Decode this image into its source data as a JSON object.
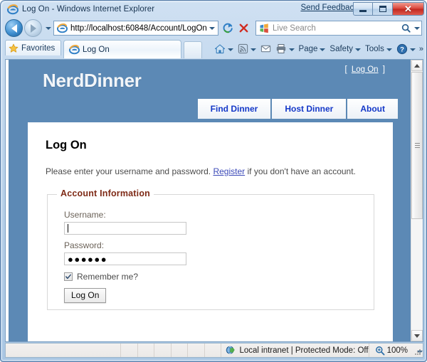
{
  "window": {
    "title": "Log On - Windows Internet Explorer",
    "favicon": "ie-logo-icon",
    "send_feedback": "Send Feedback",
    "buttons": {
      "minimize": "minimize-button",
      "maximize": "maximize-button",
      "close": "close-button",
      "close_glyph": "✕"
    }
  },
  "address_bar": {
    "back": "back-button",
    "forward": "forward-button",
    "recent_pages": "recent-pages-dropdown",
    "url": "http://localhost:60848/Account/LogOn",
    "url_dropdown": "address-dropdown",
    "refresh": "refresh-button",
    "stop": "stop-button",
    "search_placeholder": "Live Search",
    "search_provider": "live-search-icon",
    "search_go": "search-go-button",
    "search_dropdown": "search-provider-dropdown"
  },
  "toolbar": {
    "favorites_label": "Favorites",
    "tab_label": "Log On",
    "new_tab": "new-tab-button",
    "commands": [
      {
        "label": "",
        "icon": "home-icon",
        "caret": true
      },
      {
        "label": "",
        "icon": "feeds-icon",
        "caret": true
      },
      {
        "label": "",
        "icon": "mail-icon",
        "caret": false
      },
      {
        "label": "",
        "icon": "print-icon",
        "caret": true
      },
      {
        "label": "Page",
        "icon": "",
        "caret": true
      },
      {
        "label": "Safety",
        "icon": "",
        "caret": true
      },
      {
        "label": "Tools",
        "icon": "",
        "caret": true
      },
      {
        "label": "",
        "icon": "help-icon",
        "caret": true
      }
    ],
    "overflow": "»"
  },
  "page": {
    "site_title": "NerdDinner",
    "logon_bracket_open": "[",
    "logon_link": "Log On",
    "logon_bracket_close": "]",
    "nav_tabs": [
      {
        "label": "Find Dinner"
      },
      {
        "label": "Host Dinner"
      },
      {
        "label": "About"
      }
    ],
    "heading": "Log On",
    "intro_before": "Please enter your username and password. ",
    "intro_link": "Register",
    "intro_after": " if you don't have an account.",
    "fieldset_legend": "Account Information",
    "fields": {
      "username_label": "Username:",
      "username_value": "",
      "password_label": "Password:",
      "password_value": "●●●●●●"
    },
    "remember_label": "Remember me?",
    "remember_checked": true,
    "submit_label": "Log On"
  },
  "scrollbar": {
    "up": "scroll-up-button",
    "down": "scroll-down-button",
    "thumb": "scroll-thumb"
  },
  "status_bar": {
    "zone_icon": "internet-zone-icon",
    "zone_text": "Local intranet | Protected Mode: Off",
    "zoom_icon": "zoom-icon",
    "zoom_level": "100%",
    "zoom_caret": "zoom-dropdown"
  },
  "colors": {
    "page_blue": "#5c89b5",
    "link_blue": "#1438c8",
    "legend_red": "#7e2a16",
    "chrome_blue": "#b9d2ea"
  }
}
